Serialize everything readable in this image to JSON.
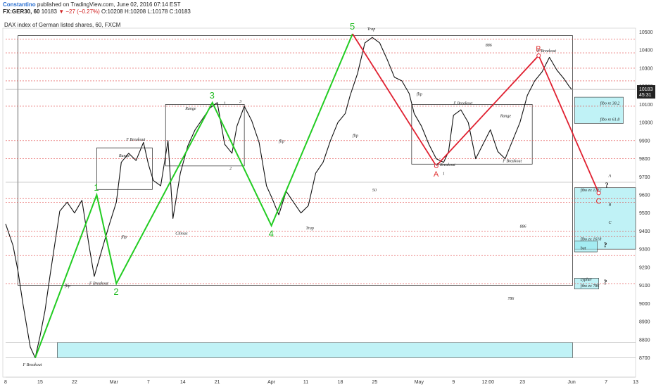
{
  "header": {
    "author": "Constantino",
    "published": "published on TradingView.com, June 02, 2016 07:14 EST",
    "symbol": "FX:GER30, 60",
    "last": "10183",
    "change": "▼ −27 (−0.27%)",
    "open": "O:10208",
    "high": "H:10208",
    "low": "L:10178",
    "close": "C:10183"
  },
  "chart_title": "DAX index of German listed shares, 60, FXCM",
  "colors": {
    "wave": "#22cc22",
    "abc": "#e02030",
    "candle": "#111111",
    "dashed_level": "#e04040",
    "box_fill": "#8de8ef",
    "last_label_bg": "#222222"
  },
  "price_badge": {
    "price": "10183",
    "countdown": "45:31"
  },
  "chart_data": {
    "type": "line",
    "title": "DAX index of German listed shares, 60, FXCM",
    "y_ticks": [
      8700,
      8800,
      8900,
      9000,
      9100,
      9200,
      9300,
      9400,
      9500,
      9600,
      9700,
      9800,
      9900,
      10000,
      10100,
      10200,
      10300,
      10400,
      10500
    ],
    "ylim": [
      8640,
      10560
    ],
    "x_ticks": [
      "8",
      "15",
      "22",
      "Mar",
      "7",
      "14",
      "21",
      "Apr",
      "11",
      "18",
      "25",
      "May",
      "9",
      "12:00",
      "23",
      "Jun",
      "7",
      "13"
    ],
    "x_domain": [
      0,
      128
    ],
    "x_tick_days": [
      0,
      7,
      14,
      22,
      29,
      36,
      43,
      54,
      61,
      68,
      75,
      84,
      91,
      98,
      105,
      115,
      122,
      128
    ],
    "last_price": 10183,
    "price_path": [
      [
        0,
        9440
      ],
      [
        1.5,
        9320
      ],
      [
        2.5,
        9180
      ],
      [
        3.5,
        9000
      ],
      [
        5,
        8760
      ],
      [
        6,
        8700
      ],
      [
        7,
        8820
      ],
      [
        8,
        8960
      ],
      [
        9,
        9150
      ],
      [
        10,
        9330
      ],
      [
        11,
        9510
      ],
      [
        12.5,
        9560
      ],
      [
        14,
        9500
      ],
      [
        15.5,
        9570
      ],
      [
        17,
        9310
      ],
      [
        18,
        9150
      ],
      [
        19.5,
        9290
      ],
      [
        21,
        9430
      ],
      [
        22.5,
        9560
      ],
      [
        23.5,
        9780
      ],
      [
        25,
        9830
      ],
      [
        26.5,
        9790
      ],
      [
        28,
        9890
      ],
      [
        29,
        9770
      ],
      [
        30,
        9680
      ],
      [
        31.5,
        9650
      ],
      [
        33,
        9900
      ],
      [
        34,
        9470
      ],
      [
        35.5,
        9720
      ],
      [
        37,
        9870
      ],
      [
        38.5,
        9960
      ],
      [
        40,
        10020
      ],
      [
        41.5,
        10080
      ],
      [
        43,
        10110
      ],
      [
        44.5,
        9880
      ],
      [
        46,
        9830
      ],
      [
        47,
        9980
      ],
      [
        48.5,
        10090
      ],
      [
        50,
        10010
      ],
      [
        51.5,
        9890
      ],
      [
        53,
        9650
      ],
      [
        54,
        9590
      ],
      [
        55.5,
        9490
      ],
      [
        57,
        9620
      ],
      [
        58.5,
        9560
      ],
      [
        60,
        9500
      ],
      [
        61.5,
        9540
      ],
      [
        63,
        9720
      ],
      [
        64.5,
        9780
      ],
      [
        66,
        9900
      ],
      [
        67.5,
        10000
      ],
      [
        69,
        10050
      ],
      [
        70,
        10150
      ],
      [
        71.5,
        10270
      ],
      [
        73,
        10440
      ],
      [
        74.5,
        10470
      ],
      [
        76,
        10440
      ],
      [
        77.5,
        10350
      ],
      [
        79,
        10250
      ],
      [
        80.5,
        10230
      ],
      [
        82,
        10160
      ],
      [
        83,
        10050
      ],
      [
        84.5,
        9980
      ],
      [
        86,
        9880
      ],
      [
        87.5,
        9800
      ],
      [
        89,
        9780
      ],
      [
        90,
        9840
      ],
      [
        91,
        10040
      ],
      [
        92.5,
        10070
      ],
      [
        94,
        10000
      ],
      [
        95.5,
        9800
      ],
      [
        97,
        9880
      ],
      [
        98.5,
        9960
      ],
      [
        100,
        9840
      ],
      [
        101.5,
        9800
      ],
      [
        103,
        9900
      ],
      [
        104.5,
        10000
      ],
      [
        106,
        10150
      ],
      [
        107.5,
        10230
      ],
      [
        109,
        10280
      ],
      [
        110.5,
        10360
      ],
      [
        112,
        10290
      ],
      [
        113.5,
        10240
      ],
      [
        114.5,
        10200
      ],
      [
        115,
        10183
      ]
    ],
    "elliott_waves": [
      {
        "label": "1",
        "x": 18.5,
        "y": 9600
      },
      {
        "label": "2",
        "x": 22.5,
        "y": 9110
      },
      {
        "label": "3",
        "x": 42,
        "y": 10110
      },
      {
        "label": "4",
        "x": 54,
        "y": 9430
      },
      {
        "label": "5",
        "x": 70.5,
        "y": 10490
      }
    ],
    "abc_projection": [
      {
        "label": "A",
        "x": 87.5,
        "y": 9760
      },
      {
        "label": "B",
        "x": 108.3,
        "y": 10370
      },
      {
        "label": "C",
        "x": 120.5,
        "y": 9610
      }
    ],
    "range_boxes": [
      {
        "label": "Range",
        "x0": 18.5,
        "x1": 29.8,
        "y0": 9630,
        "y1": 9860
      },
      {
        "label": "Range",
        "x0": 32.5,
        "x1": 48.5,
        "y0": 9760,
        "y1": 10100
      },
      {
        "label": "Range",
        "x0": 82.5,
        "x1": 107,
        "y0": 9770,
        "y1": 10100
      },
      {
        "label": "",
        "x0": 2.5,
        "x1": 115.2,
        "y0": 9100,
        "y1": 10480
      }
    ],
    "cyan_zones": [
      {
        "label": "",
        "x0": 10.5,
        "x1": 115.2,
        "y0": 8700,
        "y1": 8785
      },
      {
        "label": "fibo re 38.2 / fibo re 61.8",
        "x0": 115.6,
        "x1": 125.5,
        "y0": 9995,
        "y1": 10140
      },
      {
        "label": "fibo ex 1272 / fibo ex 1618",
        "x0": 115.6,
        "x1": 128,
        "y0": 9300,
        "y1": 9640
      },
      {
        "label": "bat",
        "x0": 115.6,
        "x1": 120.2,
        "y0": 9285,
        "y1": 9345
      },
      {
        "label": "cypher / fibo ex 786",
        "x0": 115.6,
        "x1": 120.5,
        "y0": 9080,
        "y1": 9140
      }
    ],
    "levels": [
      {
        "y": 10460,
        "style": "dashed"
      },
      {
        "y": 10385,
        "style": "dashed"
      },
      {
        "y": 10300,
        "style": "dashed"
      },
      {
        "y": 10230,
        "style": "dashed"
      },
      {
        "y": 10183,
        "style": "solid"
      },
      {
        "y": 10090,
        "style": "dashed"
      },
      {
        "y": 9900,
        "style": "dashed"
      },
      {
        "y": 9800,
        "style": "dashed"
      },
      {
        "y": 9670,
        "style": "solid"
      },
      {
        "y": 9580,
        "style": "dashed"
      },
      {
        "y": 9560,
        "style": "dashed"
      },
      {
        "y": 9400,
        "style": "dashed"
      },
      {
        "y": 9370,
        "style": "dashed"
      },
      {
        "y": 9265,
        "style": "dashed"
      },
      {
        "y": 9110,
        "style": "dashed"
      },
      {
        "y": 8785,
        "style": "solid"
      },
      {
        "y": 8700,
        "style": "solid"
      }
    ],
    "annotations": [
      {
        "text": "Trap",
        "x": 73.5,
        "y": 10510
      },
      {
        "text": "Trap",
        "x": 61,
        "y": 9410
      },
      {
        "text": "F Breakout",
        "x": 24.5,
        "y": 9900
      },
      {
        "text": "F Breakout",
        "x": 17,
        "y": 9105
      },
      {
        "text": "F Breakout",
        "x": 3.5,
        "y": 8655
      },
      {
        "text": "F Breakout",
        "x": 108,
        "y": 10390
      },
      {
        "text": "F Breakout",
        "x": 91,
        "y": 10100
      },
      {
        "text": "F Breakout",
        "x": 87.5,
        "y": 9760
      },
      {
        "text": "F Breakout",
        "x": 101,
        "y": 9780
      },
      {
        "text": "Climax",
        "x": 34.5,
        "y": 9380
      },
      {
        "text": "flip",
        "x": 55.5,
        "y": 9890
      },
      {
        "text": "flip",
        "x": 70.5,
        "y": 9920
      },
      {
        "text": "flip",
        "x": 23.5,
        "y": 9360
      },
      {
        "text": "flip",
        "x": 12,
        "y": 9090
      },
      {
        "text": "flip",
        "x": 83.5,
        "y": 10150
      },
      {
        "text": "Range",
        "x": 23,
        "y": 9810
      },
      {
        "text": "Range",
        "x": 36.5,
        "y": 10070
      },
      {
        "text": "Range",
        "x": 100.5,
        "y": 10030
      },
      {
        "text": "886",
        "x": 97.5,
        "y": 10420
      },
      {
        "text": "886",
        "x": 104.5,
        "y": 9420
      },
      {
        "text": "50",
        "x": 74.5,
        "y": 9620
      },
      {
        "text": "786",
        "x": 102,
        "y": 9020
      },
      {
        "text": "1",
        "x": 88.8,
        "y": 9710
      },
      {
        "text": "2",
        "x": 45.5,
        "y": 9740
      },
      {
        "text": "1",
        "x": 44.3,
        "y": 10100
      },
      {
        "text": "3",
        "x": 47.5,
        "y": 10110
      },
      {
        "text": "fibo re 38.2",
        "x": 120.8,
        "y": 10100
      },
      {
        "text": "fibo re 61.8",
        "x": 120.8,
        "y": 10010
      },
      {
        "text": "fibo ex 1272",
        "x": 116.8,
        "y": 9620
      },
      {
        "text": "fibo ex 1618",
        "x": 116.8,
        "y": 9350
      },
      {
        "text": "bat",
        "x": 116.8,
        "y": 9298
      },
      {
        "text": "cypher",
        "x": 116.8,
        "y": 9125
      },
      {
        "text": "fibo ex 786",
        "x": 116.8,
        "y": 9090
      },
      {
        "text": "A",
        "x": 122.5,
        "y": 9700
      },
      {
        "text": "B",
        "x": 122.5,
        "y": 9540
      },
      {
        "text": "C",
        "x": 122.5,
        "y": 9440
      }
    ],
    "question_marks": [
      {
        "text": "?",
        "x": 121.8,
        "y": 9640
      },
      {
        "text": "?",
        "x": 121.5,
        "y": 9310
      },
      {
        "text": "?",
        "x": 121.5,
        "y": 9105
      }
    ]
  }
}
